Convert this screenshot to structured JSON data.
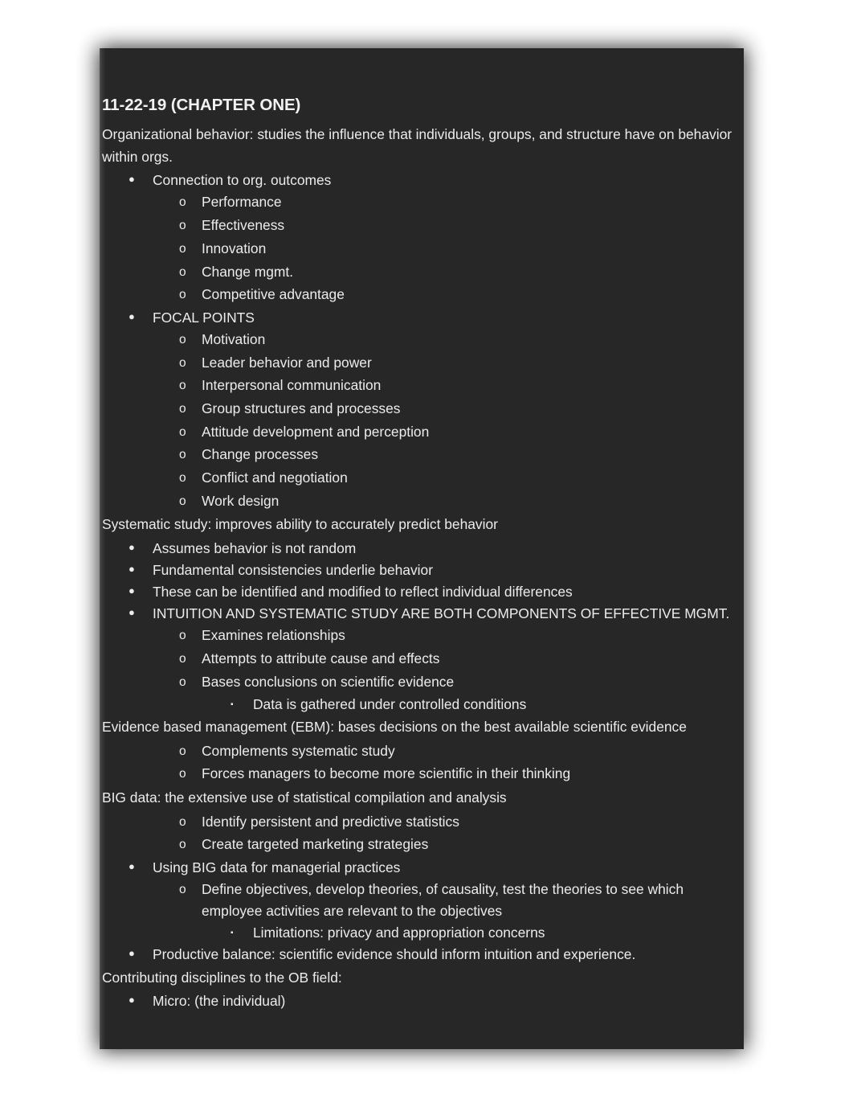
{
  "document": {
    "title": "11-22-19 (CHAPTER ONE)",
    "background_color": "#272727",
    "text_color": "#ececec",
    "markers": {
      "level1": "●",
      "level2": "o",
      "level3": "▪"
    },
    "blocks": [
      {
        "level": 0,
        "text": "Organizational behavior: studies the influence that individuals, groups, and structure have on behavior within orgs."
      },
      {
        "level": 1,
        "text": "Connection to org. outcomes"
      },
      {
        "level": 2,
        "text": "Performance"
      },
      {
        "level": 2,
        "text": "Effectiveness"
      },
      {
        "level": 2,
        "text": "Innovation"
      },
      {
        "level": 2,
        "text": "Change mgmt."
      },
      {
        "level": 2,
        "text": "Competitive advantage"
      },
      {
        "level": 1,
        "text": "FOCAL POINTS"
      },
      {
        "level": 2,
        "text": "Motivation"
      },
      {
        "level": 2,
        "text": "Leader behavior and power"
      },
      {
        "level": 2,
        "text": "Interpersonal communication"
      },
      {
        "level": 2,
        "text": "Group structures and processes"
      },
      {
        "level": 2,
        "text": "Attitude development and perception"
      },
      {
        "level": 2,
        "text": "Change processes"
      },
      {
        "level": 2,
        "text": "Conflict and negotiation"
      },
      {
        "level": 2,
        "text": "Work design"
      },
      {
        "level": 0,
        "text": "Systematic study: improves ability to accurately predict behavior"
      },
      {
        "level": 1,
        "text": "Assumes behavior is not random"
      },
      {
        "level": 1,
        "text": "Fundamental consistencies underlie behavior"
      },
      {
        "level": 1,
        "text": "These can be identified and modified to reflect individual differences"
      },
      {
        "level": 1,
        "text": "INTUITION AND SYSTEMATIC STUDY ARE BOTH COMPONENTS OF EFFECTIVE MGMT."
      },
      {
        "level": 2,
        "text": "Examines relationships"
      },
      {
        "level": 2,
        "text": "Attempts to attribute cause and effects"
      },
      {
        "level": 2,
        "text": "Bases conclusions on scientific evidence"
      },
      {
        "level": 3,
        "text": "Data is gathered under controlled conditions"
      },
      {
        "level": 0,
        "text": "Evidence based management (EBM): bases decisions on the best available scientific evidence"
      },
      {
        "level": 2,
        "text": "Complements systematic study"
      },
      {
        "level": 2,
        "text": "Forces managers to become more scientific in their thinking"
      },
      {
        "level": 0,
        "text": "BIG data: the extensive use of statistical compilation and analysis"
      },
      {
        "level": 2,
        "text": "Identify persistent and predictive statistics"
      },
      {
        "level": 2,
        "text": "Create targeted marketing strategies"
      },
      {
        "level": 1,
        "text": "Using BIG data for managerial practices"
      },
      {
        "level": 2,
        "text": "Define objectives, develop theories, of causality, test the theories to see which employee activities are relevant to the objectives"
      },
      {
        "level": 3,
        "text": "Limitations: privacy and appropriation concerns"
      },
      {
        "level": 1,
        "text": "Productive balance: scientific evidence should inform intuition and experience."
      },
      {
        "level": 0,
        "text": "Contributing disciplines to the OB field:"
      },
      {
        "level": 1,
        "text": "Micro: (the individual)"
      }
    ]
  }
}
